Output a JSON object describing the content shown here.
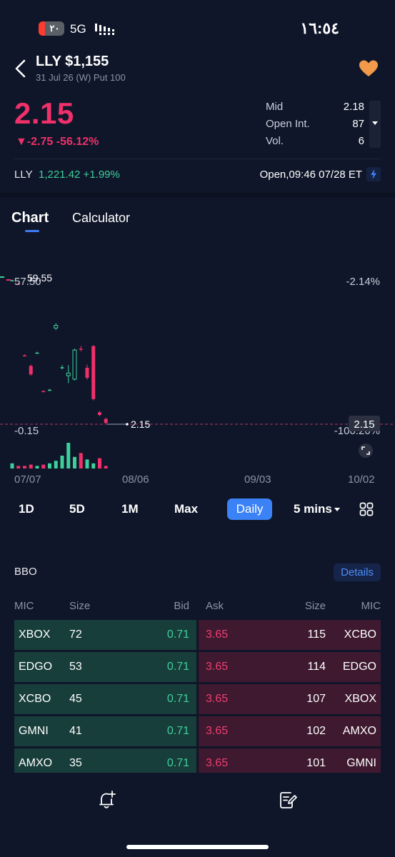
{
  "status_bar": {
    "battery": "٢٠",
    "network": "5G",
    "time": "١٦:٥٤"
  },
  "header": {
    "title": "LLY $1,155",
    "subtitle": "31 Jul 26 (W) Put 100"
  },
  "quote": {
    "price": "2.15",
    "change": "▼-2.75 -56.12%",
    "stats": [
      {
        "label": "Mid",
        "value": "2.18"
      },
      {
        "label": "Open Int.",
        "value": "87"
      },
      {
        "label": "Vol.",
        "value": "6"
      }
    ]
  },
  "underlying": {
    "symbol": "LLY",
    "value": "1,221.42 +1.99%",
    "status": "Open,09:46 07/28 ET"
  },
  "tabs": [
    "Chart",
    "Calculator"
  ],
  "chart": {
    "y_top_left": "57.50",
    "y_top_left_overlay": "59.55",
    "y_top_right": "-2.14%",
    "y_bottom_left": "-0.15",
    "y_bottom_right": "-100.20%",
    "last_price_label": "2.15",
    "last_price_tag": "2.15",
    "x_ticks": [
      "07/07",
      "08/06",
      "09/03",
      "10/02"
    ]
  },
  "chart_data": {
    "type": "candlestick",
    "ylim": [
      -0.15,
      57.5
    ],
    "last_price": 2.15,
    "candles": [
      {
        "open": 56.3,
        "close": 56.3,
        "high": 56.6,
        "low": 56.0,
        "dir": "up"
      },
      {
        "open": 55.0,
        "close": 55.0,
        "high": 55.3,
        "low": 54.7,
        "dir": "down"
      },
      {
        "open": 28.0,
        "close": 28.0,
        "high": 28.3,
        "low": 27.8,
        "dir": "down"
      },
      {
        "open": 24.0,
        "close": 20.8,
        "high": 24.5,
        "low": 20.3,
        "dir": "down"
      },
      {
        "open": 29.0,
        "close": 29.0,
        "high": 29.3,
        "low": 28.7,
        "dir": "up"
      },
      {
        "open": 14.5,
        "close": 14.5,
        "high": 14.8,
        "low": 14.2,
        "dir": "down"
      },
      {
        "open": 15.0,
        "close": 15.0,
        "high": 15.3,
        "low": 14.7,
        "dir": "up"
      },
      {
        "open": 38.3,
        "close": 39.3,
        "high": 40.1,
        "low": 37.5,
        "dir": "up"
      },
      {
        "open": 23.5,
        "close": 23.5,
        "high": 24.3,
        "low": 22.7,
        "dir": "up"
      },
      {
        "open": 20.3,
        "close": 21.3,
        "high": 24.3,
        "low": 17.5,
        "dir": "up"
      },
      {
        "open": 19.0,
        "close": 30.0,
        "high": 30.5,
        "low": 18.5,
        "dir": "up"
      },
      {
        "open": 30.5,
        "close": 30.5,
        "high": 31.5,
        "low": 29.5,
        "dir": "down"
      },
      {
        "open": 23.3,
        "close": 19.5,
        "high": 24.5,
        "low": 18.8,
        "dir": "down"
      },
      {
        "open": 31.5,
        "close": 11.5,
        "high": 31.8,
        "low": 11.0,
        "dir": "down"
      },
      {
        "open": 6.5,
        "close": 5.5,
        "high": 7.0,
        "low": 5.0,
        "dir": "down"
      },
      {
        "open": 4.0,
        "close": 2.5,
        "high": 4.5,
        "low": 2.15,
        "dir": "down"
      }
    ],
    "volume": [
      {
        "value": 0.2,
        "dir": "up"
      },
      {
        "value": 0.1,
        "dir": "down"
      },
      {
        "value": 0.1,
        "dir": "down"
      },
      {
        "value": 0.15,
        "dir": "down"
      },
      {
        "value": 0.1,
        "dir": "up"
      },
      {
        "value": 0.15,
        "dir": "down"
      },
      {
        "value": 0.2,
        "dir": "up"
      },
      {
        "value": 0.3,
        "dir": "up"
      },
      {
        "value": 0.5,
        "dir": "up"
      },
      {
        "value": 1.0,
        "dir": "up"
      },
      {
        "value": 0.45,
        "dir": "up"
      },
      {
        "value": 0.6,
        "dir": "down"
      },
      {
        "value": 0.35,
        "dir": "up"
      },
      {
        "value": 0.2,
        "dir": "up"
      },
      {
        "value": 0.4,
        "dir": "down"
      },
      {
        "value": 0.1,
        "dir": "down"
      }
    ],
    "colors": {
      "up": "#3ecf9b",
      "down": "#f0306a",
      "price_line": "#b33a62"
    }
  },
  "ranges": {
    "items": [
      "1D",
      "5D",
      "1M",
      "Max",
      "Daily",
      "5 mins"
    ],
    "active": "Daily"
  },
  "bbo": {
    "title": "BBO",
    "details_label": "Details",
    "headers": {
      "mic": "MIC",
      "size": "Size",
      "bid": "Bid",
      "ask": "Ask",
      "size2": "Size",
      "mic2": "MIC"
    },
    "rows": [
      {
        "bid_mic": "XBOX",
        "bid_size": "72",
        "bid": "0.71",
        "ask": "3.65",
        "ask_size": "115",
        "ask_mic": "XCBO"
      },
      {
        "bid_mic": "EDGO",
        "bid_size": "53",
        "bid": "0.71",
        "ask": "3.65",
        "ask_size": "114",
        "ask_mic": "EDGO"
      },
      {
        "bid_mic": "XCBO",
        "bid_size": "45",
        "bid": "0.71",
        "ask": "3.65",
        "ask_size": "107",
        "ask_mic": "XBOX"
      },
      {
        "bid_mic": "GMNI",
        "bid_size": "41",
        "bid": "0.71",
        "ask": "3.65",
        "ask_size": "102",
        "ask_mic": "AMXO"
      },
      {
        "bid_mic": "AMXO",
        "bid_size": "35",
        "bid": "0.71",
        "ask": "3.65",
        "ask_size": "101",
        "ask_mic": "GMNI"
      }
    ]
  },
  "colors": {
    "background": "#0f1629",
    "negative": "#f0306a",
    "positive": "#3ecf9b",
    "accent": "#3b82f6",
    "favorite": "#f2994a"
  },
  "icons": [
    "back-icon",
    "heart-icon",
    "bolt-icon",
    "fullscreen-icon",
    "grid-icon",
    "bell-plus-icon",
    "notes-icon"
  ]
}
